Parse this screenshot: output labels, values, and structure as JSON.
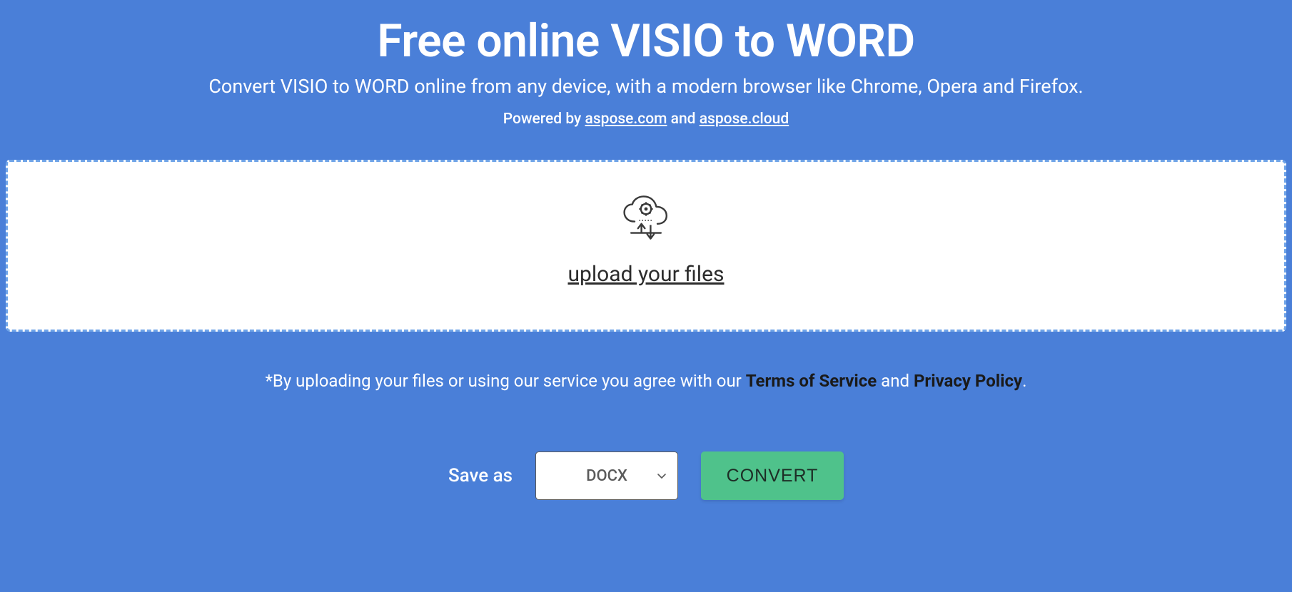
{
  "header": {
    "title": "Free online VISIO to WORD",
    "subtitle": "Convert VISIO to WORD online from any device, with a modern browser like Chrome, Opera and Firefox.",
    "powered_prefix": "Powered by ",
    "powered_link1": "aspose.com",
    "powered_mid": " and ",
    "powered_link2": "aspose.cloud"
  },
  "dropzone": {
    "upload_label": "upload your files"
  },
  "disclaimer": {
    "prefix": "*By uploading your files or using our service you agree with our ",
    "terms": "Terms of Service",
    "mid": " and ",
    "privacy": "Privacy Policy",
    "suffix": "."
  },
  "controls": {
    "save_as_label": "Save as",
    "selected_format": "DOCX",
    "convert_label": "CONVERT"
  }
}
